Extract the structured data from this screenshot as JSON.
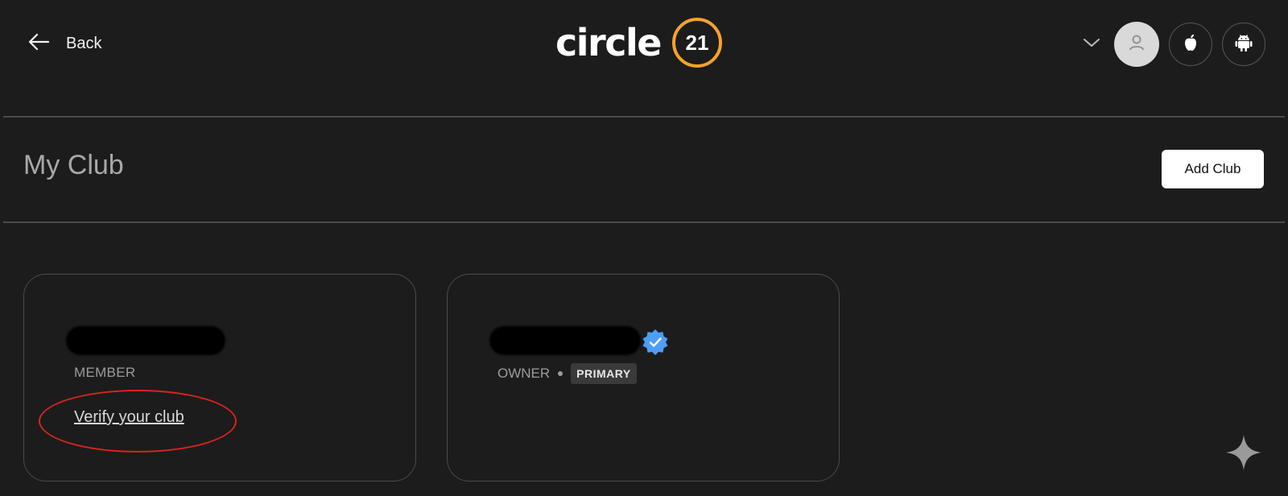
{
  "header": {
    "back_label": "Back",
    "logo_word": "circle",
    "logo_badge": "21",
    "icons": [
      "arrow-left-icon",
      "chevron-down-icon",
      "user-icon",
      "apple-icon",
      "android-icon"
    ]
  },
  "page": {
    "title": "My Club",
    "add_club_label": "Add Club"
  },
  "cards": [
    {
      "role": "MEMBER",
      "verify_link": "Verify your club"
    },
    {
      "role": "OWNER",
      "badge": "PRIMARY",
      "verified_icon": "verified-badge-icon"
    }
  ],
  "colors": {
    "background": "#1c1c1c",
    "logo_ring": "#f5a32a",
    "verified_blue": "#4d9ef5",
    "annotation_red": "#d8241c",
    "divider": "#4a4a4a"
  }
}
